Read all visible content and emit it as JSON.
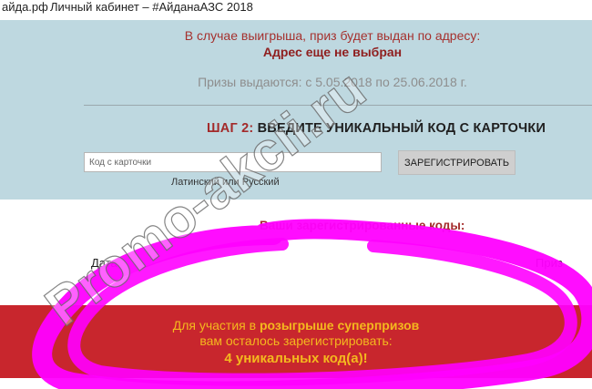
{
  "browser": {
    "site": "айда.рф",
    "title": "Личный кабинет – #АйданаАЗС 2018"
  },
  "prize": {
    "address_label": "В случае выигрыша, приз будет выдан по адресу:",
    "address_value": "Адрес еще не выбран",
    "dates": "Призы выдаются: с 5.05.2018 по 25.06.2018 г."
  },
  "step": {
    "number": "ШАГ 2:",
    "text": "ВВЕДИТЕ УНИКАЛЬНЫЙ КОД С КАРТОЧКИ"
  },
  "form": {
    "placeholder": "Код с карточки",
    "button": "ЗАРЕГИСТРИРОВАТЬ",
    "hint": "Латинский или Русский"
  },
  "codes": {
    "title": "Ваши зарегистрированные коды:",
    "col_date": "Дата",
    "col_prize": "Приз"
  },
  "promo": {
    "line1_start": "Для участия в",
    "line1_bold": "розыгрыше суперпризов",
    "line2": "вам осталось зарегистрировать:",
    "line3": "4 уникальных код(а)!"
  },
  "watermark": "Promo-akcii.ru",
  "colors": {
    "blue_panel": "#bed8e0",
    "red_banner": "#c8262d",
    "promo_text": "#f4b81e",
    "accent_red": "#a32a2a",
    "scribble": "#ff00ff"
  }
}
